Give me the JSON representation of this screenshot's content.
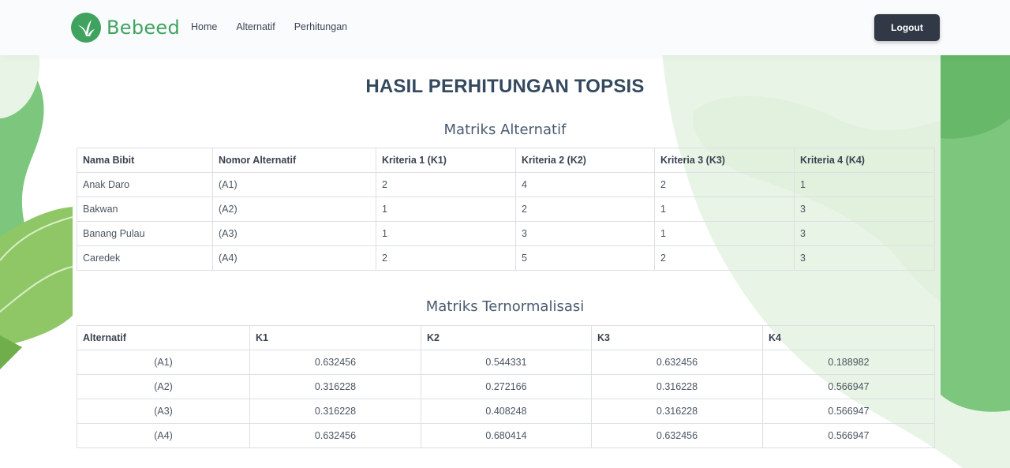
{
  "brand": {
    "name": "Bebeed",
    "logo_icon": "sprout-logo-icon",
    "color": "#3fa35f"
  },
  "nav": {
    "items": [
      "Home",
      "Alternatif",
      "Perhitungan"
    ],
    "logout_label": "Logout"
  },
  "page_title": "HASIL PERHITUNGAN TOPSIS",
  "alternatives": {
    "title": "Matriks Alternatif",
    "columns": [
      "Nama Bibit",
      "Nomor Alternatif",
      "Kriteria 1 (K1)",
      "Kriteria 2 (K2)",
      "Kriteria 3 (K3)",
      "Kriteria 4 (K4)"
    ],
    "rows": [
      [
        "Anak Daro",
        "(A1)",
        "2",
        "4",
        "2",
        "1"
      ],
      [
        "Bakwan",
        "(A2)",
        "1",
        "2",
        "1",
        "3"
      ],
      [
        "Banang Pulau",
        "(A3)",
        "1",
        "3",
        "1",
        "3"
      ],
      [
        "Caredek",
        "(A4)",
        "2",
        "5",
        "2",
        "3"
      ]
    ]
  },
  "normalized": {
    "title": "Matriks Ternormalisasi",
    "columns": [
      "Alternatif",
      "K1",
      "K2",
      "K3",
      "K4"
    ],
    "rows": [
      [
        "(A1)",
        "0.632456",
        "0.544331",
        "0.632456",
        "0.188982"
      ],
      [
        "(A2)",
        "0.316228",
        "0.272166",
        "0.316228",
        "0.566947"
      ],
      [
        "(A3)",
        "0.316228",
        "0.408248",
        "0.316228",
        "0.566947"
      ],
      [
        "(A4)",
        "0.632456",
        "0.680414",
        "0.632456",
        "0.566947"
      ]
    ]
  },
  "colors": {
    "accent_green": "#3fa35f",
    "logout_bg": "#313846",
    "title": "#34495e"
  }
}
